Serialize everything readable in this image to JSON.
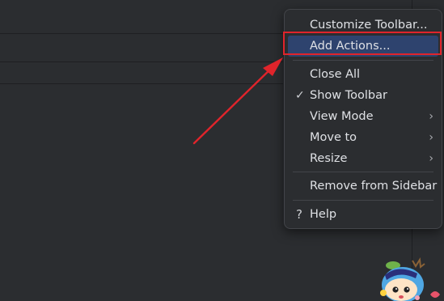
{
  "menu": {
    "items": [
      {
        "label": "Customize Toolbar...",
        "selected": false
      },
      {
        "label": "Add Actions...",
        "selected": true
      },
      {
        "label": "Close All"
      },
      {
        "label": "Show Toolbar",
        "checked": true
      },
      {
        "label": "View Mode",
        "submenu": true
      },
      {
        "label": "Move to",
        "submenu": true
      },
      {
        "label": "Resize",
        "submenu": true
      },
      {
        "label": "Remove from Sidebar"
      },
      {
        "label": "Help",
        "icon": "question-icon"
      }
    ],
    "check_glyph": "✓",
    "chevron_glyph": "›",
    "help_glyph": "?"
  },
  "annotation": {
    "color": "#e0242b"
  }
}
